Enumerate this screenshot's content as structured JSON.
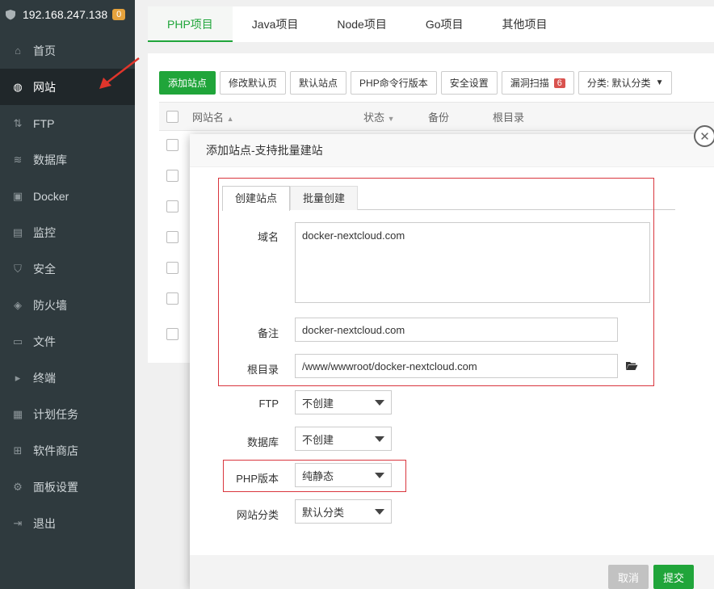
{
  "sidebar": {
    "server_ip": "192.168.247.138",
    "badge": "0",
    "items": [
      {
        "label": "首页",
        "icon": "home-icon"
      },
      {
        "label": "网站",
        "icon": "globe-icon",
        "active": true
      },
      {
        "label": "FTP",
        "icon": "ftp-icon"
      },
      {
        "label": "数据库",
        "icon": "database-icon"
      },
      {
        "label": "Docker",
        "icon": "docker-icon"
      },
      {
        "label": "监控",
        "icon": "monitor-icon"
      },
      {
        "label": "安全",
        "icon": "shield-check-icon"
      },
      {
        "label": "防火墙",
        "icon": "firewall-icon"
      },
      {
        "label": "文件",
        "icon": "folder-icon"
      },
      {
        "label": "终端",
        "icon": "terminal-icon"
      },
      {
        "label": "计划任务",
        "icon": "calendar-icon"
      },
      {
        "label": "软件商店",
        "icon": "apps-icon"
      },
      {
        "label": "面板设置",
        "icon": "gear-icon"
      },
      {
        "label": "退出",
        "icon": "logout-icon"
      }
    ]
  },
  "top_tabs": [
    "PHP项目",
    "Java项目",
    "Node项目",
    "Go项目",
    "其他项目"
  ],
  "toolbar": {
    "add_site": "添加站点",
    "edit_default_page": "修改默认页",
    "default_site": "默认站点",
    "php_cli_version": "PHP命令行版本",
    "security_settings": "安全设置",
    "vuln_scan": "漏洞扫描",
    "vuln_count": "6",
    "category": "分类: 默认分类"
  },
  "table": {
    "headers": [
      "网站名",
      "状态",
      "备份",
      "根目录"
    ]
  },
  "dialog": {
    "title": "添加站点-支持批量建站",
    "tabs": [
      "创建站点",
      "批量创建"
    ],
    "domain_label": "域名",
    "domain_value": "docker-nextcloud.com",
    "remark_label": "备注",
    "remark_value": "docker-nextcloud.com",
    "root_label": "根目录",
    "root_value": "/www/wwwroot/docker-nextcloud.com",
    "ftp_label": "FTP",
    "ftp_value": "不创建",
    "db_label": "数据库",
    "db_value": "不创建",
    "php_label": "PHP版本",
    "php_value": "纯静态",
    "category_label": "网站分类",
    "category_value": "默认分类",
    "cancel": "取消",
    "submit": "提交"
  },
  "colors": {
    "accent": "#20a53a",
    "sidebar_bg": "#2f3a3e",
    "highlight_red": "#d9363e",
    "badge_orange": "#e6a23c"
  }
}
